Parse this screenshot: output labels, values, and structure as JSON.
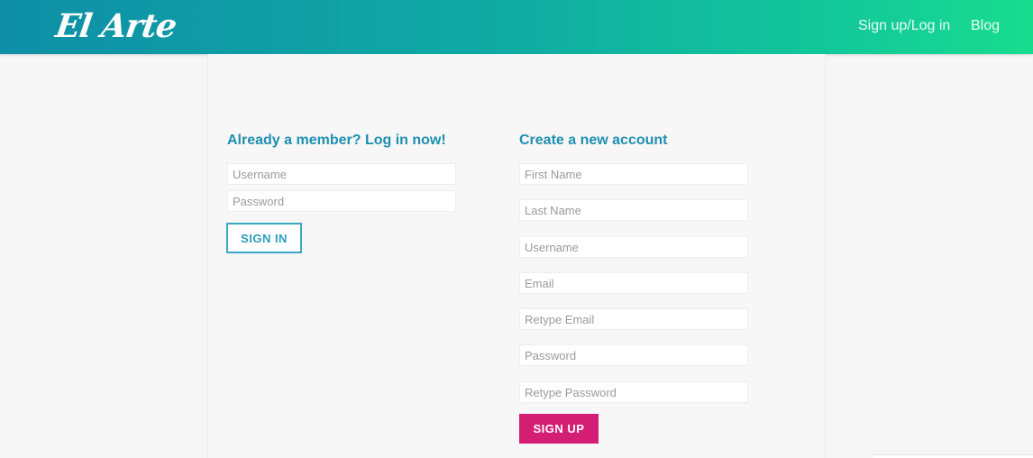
{
  "header": {
    "logo_text": "El Arte",
    "nav": {
      "signup_login": "Sign up/Log in",
      "blog": "Blog"
    }
  },
  "login": {
    "heading": "Already a member? Log in now!",
    "username_placeholder": "Username",
    "password_placeholder": "Password",
    "signin_label": "SIGN IN"
  },
  "register": {
    "heading": "Create a new account",
    "first_name_placeholder": "First Name",
    "last_name_placeholder": "Last Name",
    "username_placeholder": "Username",
    "email_placeholder": "Email",
    "retype_email_placeholder": "Retype Email",
    "password_placeholder": "Password",
    "retype_password_placeholder": "Retype Password",
    "signup_label": "SIGN UP"
  },
  "colors": {
    "header_gradient_start": "#0e8fa6",
    "header_gradient_end": "#17dc8f",
    "heading": "#1f8fb0",
    "signin_border": "#38a9c4",
    "signup_button": "#d41e73",
    "page_background": "#f6f6f6"
  }
}
